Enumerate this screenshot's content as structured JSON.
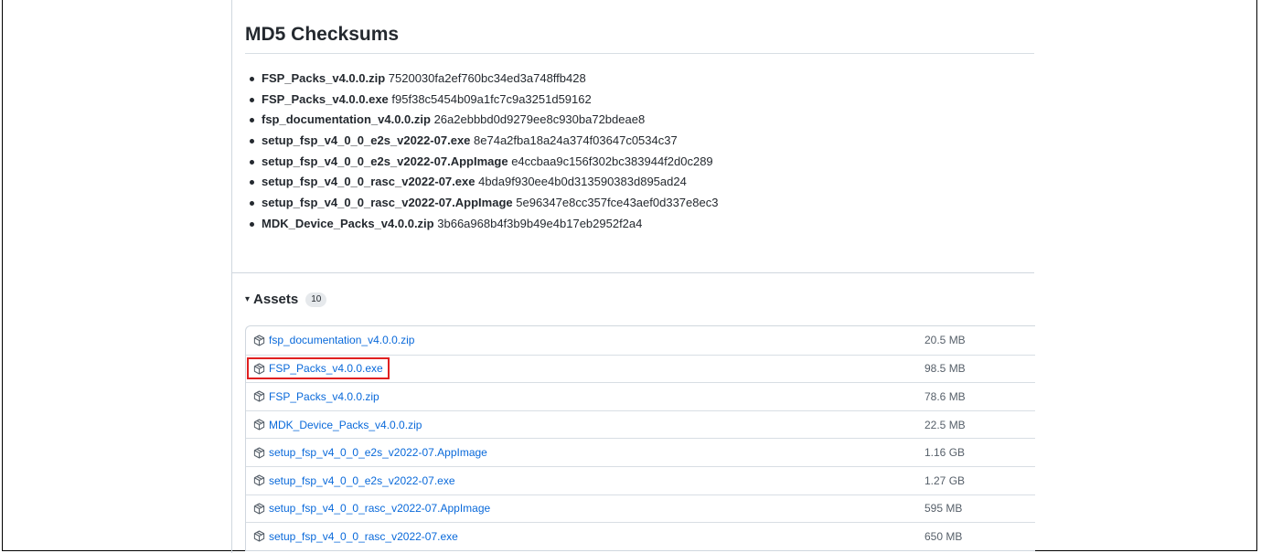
{
  "checksums": {
    "title": "MD5 Checksums",
    "items": [
      {
        "file": "FSP_Packs_v4.0.0.zip",
        "hash": "7520030fa2ef760bc34ed3a748ffb428"
      },
      {
        "file": "FSP_Packs_v4.0.0.exe",
        "hash": "f95f38c5454b09a1fc7c9a3251d59162"
      },
      {
        "file": "fsp_documentation_v4.0.0.zip",
        "hash": "26a2ebbbd0d9279ee8c930ba72bdeae8"
      },
      {
        "file": "setup_fsp_v4_0_0_e2s_v2022-07.exe",
        "hash": "8e74a2fba18a24a374f03647c0534c37"
      },
      {
        "file": "setup_fsp_v4_0_0_e2s_v2022-07.AppImage",
        "hash": "e4ccbaa9c156f302bc383944f2d0c289"
      },
      {
        "file": "setup_fsp_v4_0_0_rasc_v2022-07.exe",
        "hash": "4bda9f930ee4b0d313590383d895ad24"
      },
      {
        "file": "setup_fsp_v4_0_0_rasc_v2022-07.AppImage",
        "hash": "5e96347e8cc357fce43aef0d337e8ec3"
      },
      {
        "file": "MDK_Device_Packs_v4.0.0.zip",
        "hash": "3b66a968b4f3b9b49e4b17eb2952f2a4"
      }
    ]
  },
  "assets": {
    "caret": "▾",
    "heading": "Assets",
    "count": "10",
    "icon": "package-icon",
    "highlight_color": "#e02020",
    "link_color": "#0969da",
    "items": [
      {
        "name": "fsp_documentation_v4.0.0.zip",
        "size": "20.5 MB"
      },
      {
        "name": "FSP_Packs_v4.0.0.exe",
        "size": "98.5 MB",
        "highlighted": true
      },
      {
        "name": "FSP_Packs_v4.0.0.zip",
        "size": "78.6 MB"
      },
      {
        "name": "MDK_Device_Packs_v4.0.0.zip",
        "size": "22.5 MB"
      },
      {
        "name": "setup_fsp_v4_0_0_e2s_v2022-07.AppImage",
        "size": "1.16 GB"
      },
      {
        "name": "setup_fsp_v4_0_0_e2s_v2022-07.exe",
        "size": "1.27 GB"
      },
      {
        "name": "setup_fsp_v4_0_0_rasc_v2022-07.AppImage",
        "size": "595 MB"
      },
      {
        "name": "setup_fsp_v4_0_0_rasc_v2022-07.exe",
        "size": "650 MB"
      }
    ]
  }
}
